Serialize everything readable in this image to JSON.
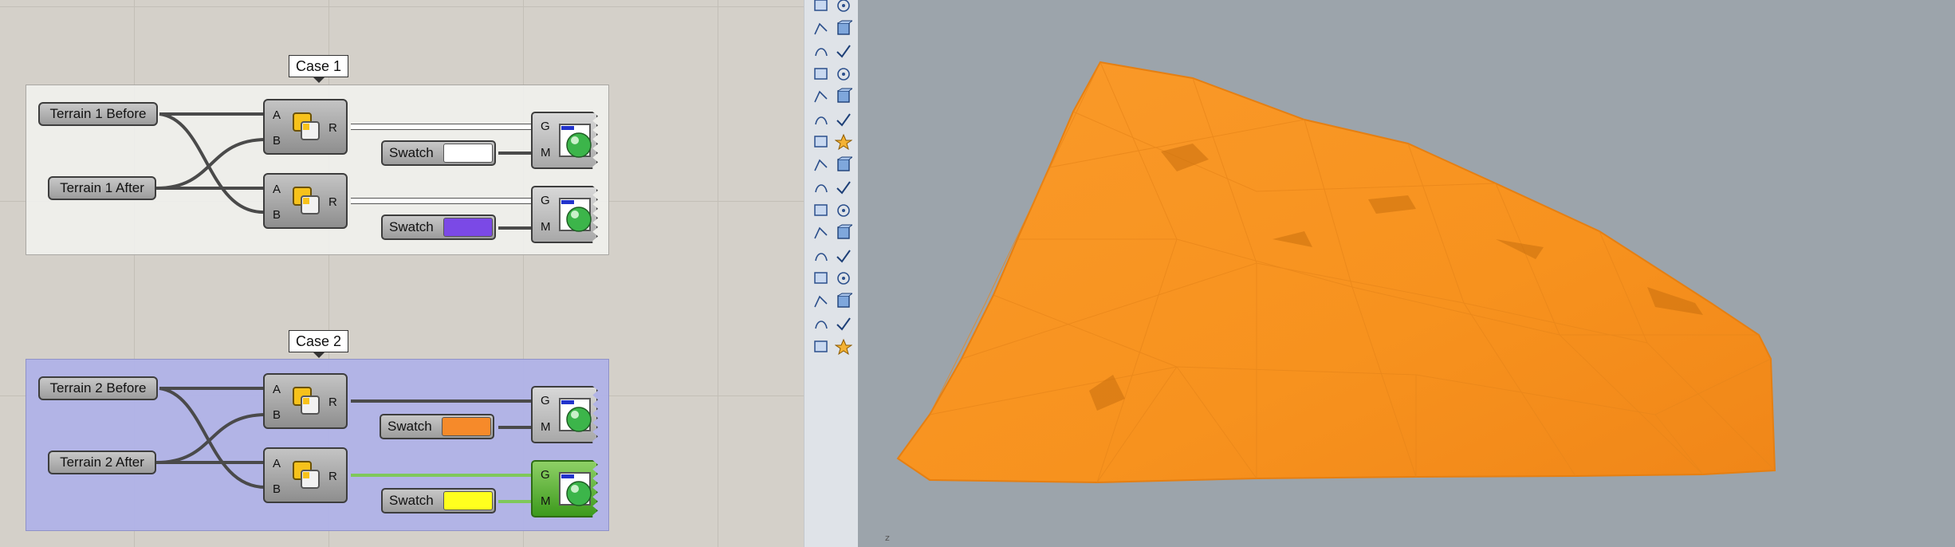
{
  "grasshopper": {
    "groups": [
      {
        "title": "Case 1",
        "inputs": [
          "Terrain 1 Before",
          "Terrain 1 After"
        ],
        "components": [
          {
            "inputs": [
              "A",
              "B"
            ],
            "output": "R"
          },
          {
            "inputs": [
              "A",
              "B"
            ],
            "output": "R"
          }
        ],
        "swatches": [
          {
            "label": "Swatch",
            "color": "#ffffff"
          },
          {
            "label": "Swatch",
            "color": "#7b49e6"
          }
        ],
        "previews": [
          {
            "inputs": [
              "G",
              "M"
            ],
            "selected": false
          },
          {
            "inputs": [
              "G",
              "M"
            ],
            "selected": false
          }
        ]
      },
      {
        "title": "Case 2",
        "inputs": [
          "Terrain 2 Before",
          "Terrain 2 After"
        ],
        "components": [
          {
            "inputs": [
              "A",
              "B"
            ],
            "output": "R"
          },
          {
            "inputs": [
              "A",
              "B"
            ],
            "output": "R"
          }
        ],
        "swatches": [
          {
            "label": "Swatch",
            "color": "#f68a2a"
          },
          {
            "label": "Swatch",
            "color": "#ffff1e"
          }
        ],
        "previews": [
          {
            "inputs": [
              "G",
              "M"
            ],
            "selected": false
          },
          {
            "inputs": [
              "G",
              "M"
            ],
            "selected": true
          }
        ]
      }
    ],
    "colors": {
      "group_case1": "#efefec",
      "group_case2": "#b0b2e8",
      "selected_component": "#5fb83a",
      "selected_wire": "#7fc85a",
      "wire": "#4a4a4a"
    }
  },
  "rhino": {
    "toolbar_icons": [
      "point-icon",
      "ellipse-icon",
      "polyline-icon",
      "rectangle-icon",
      "circle-icon",
      "arc-icon",
      "curve-edit-icon",
      "fillet-icon",
      "box-icon",
      "sphere-icon",
      "extrude-icon",
      "surface-icon",
      "gumball-icon",
      "explode-icon",
      "move-icon",
      "copy-icon",
      "boolean-union-icon",
      "boolean-split-icon",
      "rotate-icon",
      "scale-icon",
      "text-icon",
      "dimension-icon",
      "group-icon",
      "layer-icon",
      "mesh-icon",
      "measure-icon",
      "array-icon",
      "analyze-icon",
      "render-icon",
      "check-icon",
      "block-icon",
      "paint-icon"
    ],
    "viewport": {
      "background": "#9ca4ab",
      "mesh_color": "#f7921e",
      "world_axis_label": "z"
    }
  }
}
